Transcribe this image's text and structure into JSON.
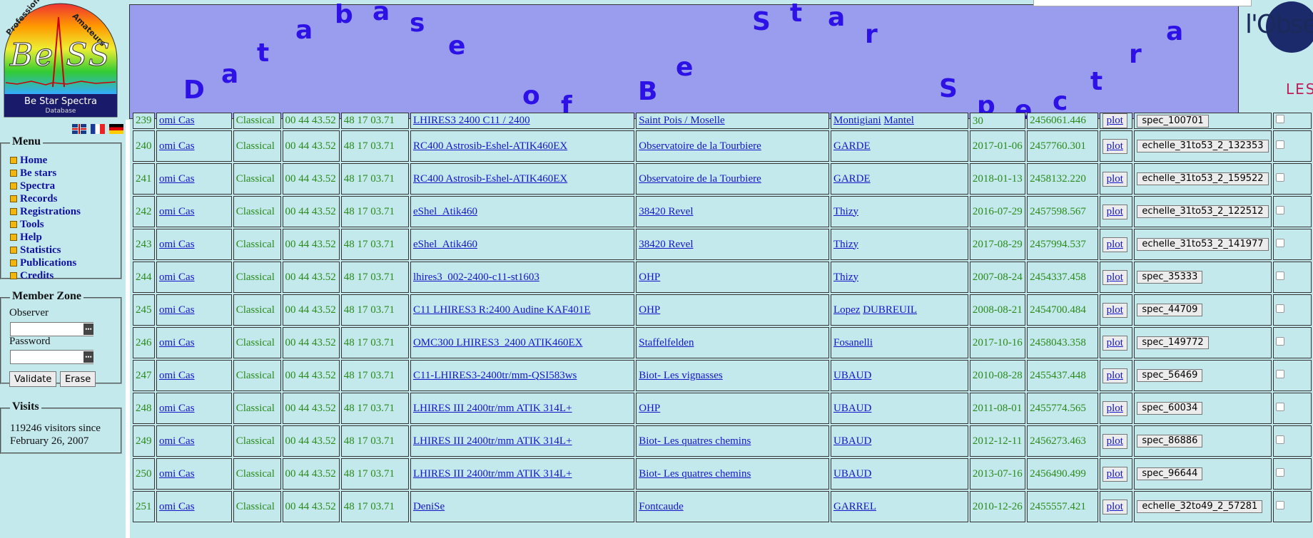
{
  "logo": {
    "title": "Be SS",
    "arc_left": "Professionals",
    "arc_right": "Amateurs",
    "subtitle": "Be Star Spectra",
    "caption": "Database"
  },
  "banner": {
    "letters": [
      "D",
      "a",
      "t",
      "a",
      "b",
      "a",
      "s",
      "e",
      "o",
      "f",
      "B",
      "e",
      "S",
      "t",
      "a",
      "r",
      "S",
      "p",
      "e",
      "c",
      "t",
      "r",
      "a"
    ]
  },
  "observatory": {
    "name": "l'Obser",
    "subtitle": "LES"
  },
  "sidebar": {
    "flags": [
      "english-flag",
      "french-flag",
      "german-flag"
    ],
    "menu_title": "Menu",
    "menu_items": [
      "Home",
      "Be stars",
      "Spectra",
      "Records",
      "Registrations",
      "Tools",
      "Help",
      "Statistics",
      "Publications",
      "Credits"
    ],
    "member_title": "Member Zone",
    "observer_label": "Observer",
    "password_label": "Password",
    "validate_label": "Validate",
    "erase_label": "Erase",
    "visits_title": "Visits",
    "visits_text": "119246 visitors since February 26, 2007"
  },
  "table": {
    "top_row": {
      "num": "239",
      "star": "omi Cas",
      "type": "Classical",
      "ra": "00 44 43.52",
      "dec": "48 17 03.71",
      "instrument": "LHIRES3 2400 C11 / 2400",
      "site": "Saint Pois / Moselle",
      "observer": "Montigiani",
      "observer2": "Mantel",
      "date": "30",
      "jd": "2456061.446",
      "spec": "spec_100701"
    },
    "plot_label": "plot",
    "rows": [
      {
        "num": "240",
        "star": "omi Cas",
        "type": "Classical",
        "ra": "00 44 43.52",
        "dec": "48 17 03.71",
        "instrument": "RC400 Astrosib-Eshel-ATIK460EX",
        "site": "Observatoire de la Tourbiere",
        "observer": "GARDE",
        "observer2": "",
        "date": "2017-01-06",
        "jd": "2457760.301",
        "spec": "echelle_31to53_2_132353"
      },
      {
        "num": "241",
        "star": "omi Cas",
        "type": "Classical",
        "ra": "00 44 43.52",
        "dec": "48 17 03.71",
        "instrument": "RC400 Astrosib-Eshel-ATIK460EX",
        "site": "Observatoire de la Tourbiere",
        "observer": "GARDE",
        "observer2": "",
        "date": "2018-01-13",
        "jd": "2458132.220",
        "spec": "echelle_31to53_2_159522"
      },
      {
        "num": "242",
        "star": "omi Cas",
        "type": "Classical",
        "ra": "00 44 43.52",
        "dec": "48 17 03.71",
        "instrument": "eShel_Atik460",
        "site": "38420 Revel",
        "observer": "Thizy",
        "observer2": "",
        "date": "2016-07-29",
        "jd": "2457598.567",
        "spec": "echelle_31to53_2_122512"
      },
      {
        "num": "243",
        "star": "omi Cas",
        "type": "Classical",
        "ra": "00 44 43.52",
        "dec": "48 17 03.71",
        "instrument": "eShel_Atik460",
        "site": "38420 Revel",
        "observer": "Thizy",
        "observer2": "",
        "date": "2017-08-29",
        "jd": "2457994.537",
        "spec": "echelle_31to53_2_141977"
      },
      {
        "num": "244",
        "star": "omi Cas",
        "type": "Classical",
        "ra": "00 44 43.52",
        "dec": "48 17 03.71",
        "instrument": "lhires3_002-2400-c11-st1603",
        "site": "OHP",
        "observer": "Thizy",
        "observer2": "",
        "date": "2007-08-24",
        "jd": "2454337.458",
        "spec": "spec_35333"
      },
      {
        "num": "245",
        "star": "omi Cas",
        "type": "Classical",
        "ra": "00 44 43.52",
        "dec": "48 17 03.71",
        "instrument": "C11 LHIRES3 R:2400 Audine KAF401E",
        "site": "OHP",
        "observer": "Lopez",
        "observer2": "DUBREUIL",
        "date": "2008-08-21",
        "jd": "2454700.484",
        "spec": "spec_44709"
      },
      {
        "num": "246",
        "star": "omi Cas",
        "type": "Classical",
        "ra": "00 44 43.52",
        "dec": "48 17 03.71",
        "instrument": "OMC300 LHIRES3_2400 ATIK460EX",
        "site": "Staffelfelden",
        "observer": "Fosanelli",
        "observer2": "",
        "date": "2017-10-16",
        "jd": "2458043.358",
        "spec": "spec_149772"
      },
      {
        "num": "247",
        "star": "omi Cas",
        "type": "Classical",
        "ra": "00 44 43.52",
        "dec": "48 17 03.71",
        "instrument": "C11-LHIRES3-2400tr/mm-QSI583ws",
        "site": "Biot- Les vignasses",
        "observer": "UBAUD",
        "observer2": "",
        "date": "2010-08-28",
        "jd": "2455437.448",
        "spec": "spec_56469"
      },
      {
        "num": "248",
        "star": "omi Cas",
        "type": "Classical",
        "ra": "00 44 43.52",
        "dec": "48 17 03.71",
        "instrument": "LHIRES III 2400tr/mm ATIK 314L+",
        "site": "OHP",
        "observer": "UBAUD",
        "observer2": "",
        "date": "2011-08-01",
        "jd": "2455774.565",
        "spec": "spec_60034"
      },
      {
        "num": "249",
        "star": "omi Cas",
        "type": "Classical",
        "ra": "00 44 43.52",
        "dec": "48 17 03.71",
        "instrument": "LHIRES III 2400tr/mm ATIK 314L+",
        "site": "Biot- Les quatres chemins",
        "observer": "UBAUD",
        "observer2": "",
        "date": "2012-12-11",
        "jd": "2456273.463",
        "spec": "spec_86886"
      },
      {
        "num": "250",
        "star": "omi Cas",
        "type": "Classical",
        "ra": "00 44 43.52",
        "dec": "48 17 03.71",
        "instrument": "LHIRES III 2400tr/mm ATIK 314L+",
        "site": "Biot- Les quatres chemins",
        "observer": "UBAUD",
        "observer2": "",
        "date": "2013-07-16",
        "jd": "2456490.499",
        "spec": "spec_96644"
      },
      {
        "num": "251",
        "star": "omi Cas",
        "type": "Classical",
        "ra": "00 44 43.52",
        "dec": "48 17 03.71",
        "instrument": "DeniSe",
        "site": "Fontcaude",
        "observer": "GARREL",
        "observer2": "",
        "date": "2010-12-26",
        "jd": "2455557.421",
        "spec": "echelle_32to49_2_57281"
      }
    ]
  },
  "colors": {
    "page_bg": "#c3e9ec",
    "banner_bg": "#9a9ded",
    "banner_text": "#2d11e6",
    "link": "#1515c8",
    "cell_text": "#2a8a1a"
  }
}
